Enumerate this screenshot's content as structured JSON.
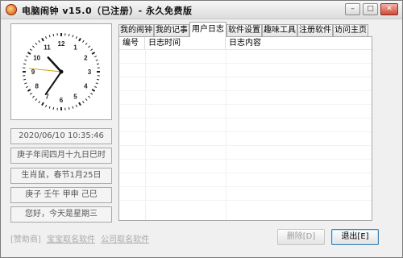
{
  "window": {
    "title": "电脑闹钟 v15.0（已注册）- 永久免费版",
    "controls": {
      "minimize_icon": "minimize-icon",
      "maximize_icon": "maximize-icon",
      "close_icon": "close-icon"
    }
  },
  "clock": {
    "numbers": [
      "12",
      "1",
      "2",
      "3",
      "4",
      "5",
      "6",
      "7",
      "8",
      "9",
      "10",
      "11"
    ],
    "time": {
      "hour": 10,
      "minute": 35,
      "second": 46
    },
    "colors": {
      "hands": "#111111",
      "second_hand": "#d4a017",
      "ticks": "#222222"
    }
  },
  "info": {
    "date": "2020/06/10 10:35:46",
    "lunar": "庚子年闰四月十九日巳时",
    "zodiac": "生肖鼠，春节1月25日",
    "ganzhi": "庚子 壬午 甲申 己巳",
    "weekday": "您好，今天是星期三"
  },
  "tabs": [
    {
      "label": "我的闹钟",
      "active": false
    },
    {
      "label": "我的记事",
      "active": false
    },
    {
      "label": "用户日志",
      "active": true
    },
    {
      "label": "软件设置",
      "active": false
    },
    {
      "label": "趣味工具",
      "active": false
    },
    {
      "label": "注册软件",
      "active": false
    },
    {
      "label": "访问主页",
      "active": false
    }
  ],
  "log": {
    "columns": [
      "编号",
      "日志时间",
      "日志内容"
    ],
    "rows": []
  },
  "footer": {
    "sponsor_label": "[赞助商]",
    "sponsor_links": [
      "宝宝取名软件",
      "公司取名软件"
    ],
    "delete_button": "删除[D]",
    "exit_button": "退出[E]"
  }
}
